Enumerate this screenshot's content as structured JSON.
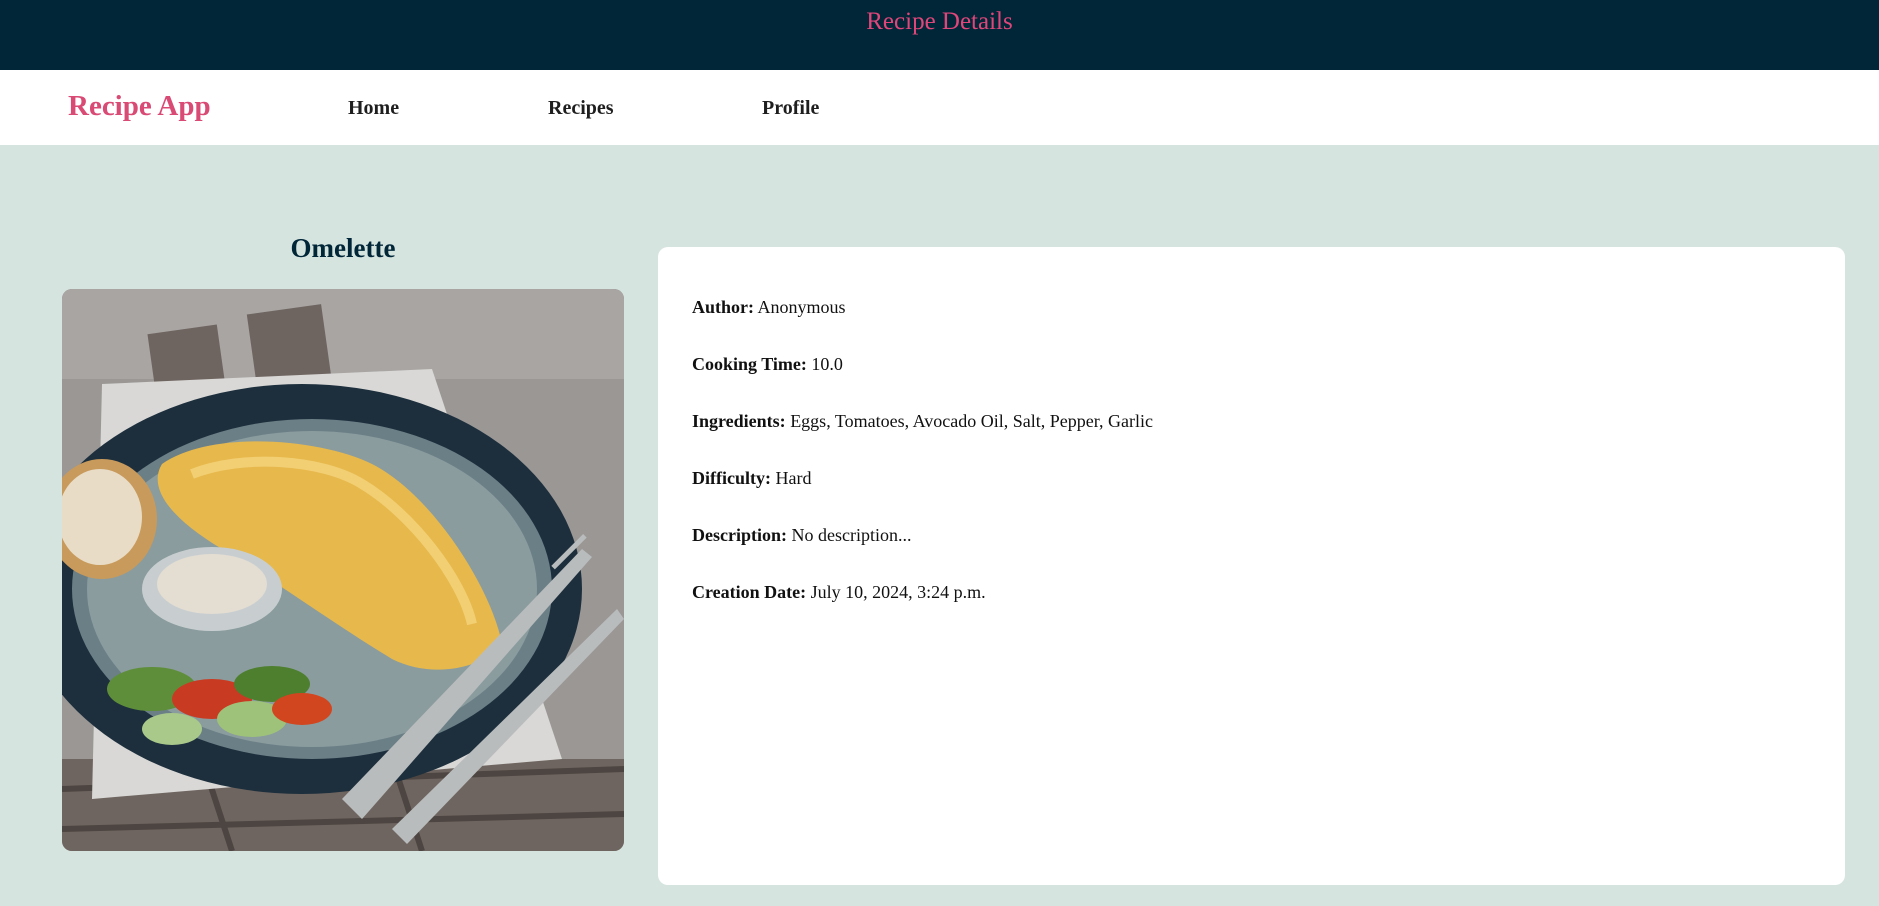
{
  "banner": {
    "title": "Recipe Details"
  },
  "nav": {
    "brand": "Recipe App",
    "links": [
      "Home",
      "Recipes",
      "Profile"
    ]
  },
  "recipe": {
    "name": "Omelette",
    "image_icon": "omelette-photo",
    "details": [
      {
        "label": "Author:",
        "value": "Anonymous"
      },
      {
        "label": "Cooking Time:",
        "value": "10.0"
      },
      {
        "label": "Ingredients:",
        "value": "Eggs, Tomatoes, Avocado Oil, Salt, Pepper, Garlic"
      },
      {
        "label": "Difficulty:",
        "value": "Hard"
      },
      {
        "label": "Description:",
        "value": "No description..."
      },
      {
        "label": "Creation Date:",
        "value": "July 10, 2024, 3:24 p.m."
      }
    ]
  },
  "colors": {
    "banner_bg": "#012638",
    "accent": "#e0467a",
    "page_bg": "#d6e4e0",
    "card_bg": "#ffffff"
  }
}
